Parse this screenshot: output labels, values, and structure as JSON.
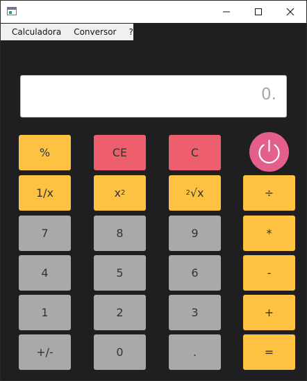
{
  "titlebar": {
    "app_icon": "window-app-icon",
    "minimize_icon": "minimize-icon",
    "maximize_icon": "maximize-icon",
    "close_icon": "close-icon"
  },
  "menu": {
    "items": [
      "Calculadora",
      "Conversor",
      "?"
    ]
  },
  "display": {
    "value": "0."
  },
  "buttons": {
    "percent": "%",
    "ce": "CE",
    "c": "C",
    "reciprocal": "1/x",
    "square_base": "x",
    "square_exp": "2",
    "sqrt_index": "2",
    "sqrt_rest": "√x",
    "divide": "÷",
    "seven": "7",
    "eight": "8",
    "nine": "9",
    "multiply": "*",
    "four": "4",
    "five": "5",
    "six": "6",
    "minus": "-",
    "one": "1",
    "two": "2",
    "three": "3",
    "plus": "+",
    "negate": "+/-",
    "zero": "0",
    "decimal": ".",
    "equals": "="
  },
  "power": {
    "icon": "power-icon"
  },
  "colors": {
    "background": "#1f1e21",
    "yellow": "#fdc242",
    "red": "#ee5f6e",
    "gray": "#a9a9a9",
    "power": "#e55f8c"
  }
}
